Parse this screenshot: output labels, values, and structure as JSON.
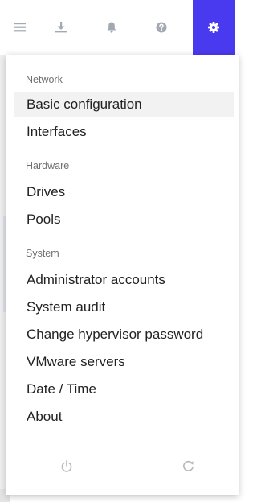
{
  "toolbar": {
    "icons": [
      "menu-icon",
      "download-icon",
      "bell-icon",
      "help-icon",
      "gear-icon"
    ],
    "active_color": "#4a3aef"
  },
  "menu": {
    "groups": [
      {
        "label": "Network",
        "items": [
          "Basic configuration",
          "Interfaces"
        ]
      },
      {
        "label": "Hardware",
        "items": [
          "Drives",
          "Pools"
        ]
      },
      {
        "label": "System",
        "items": [
          "Administrator accounts",
          "System audit",
          "Change hypervisor password",
          "VMware servers",
          "Date / Time",
          "About"
        ]
      }
    ],
    "active_item": "Basic configuration"
  },
  "footer": {
    "icons": [
      "power-icon",
      "refresh-icon"
    ]
  }
}
